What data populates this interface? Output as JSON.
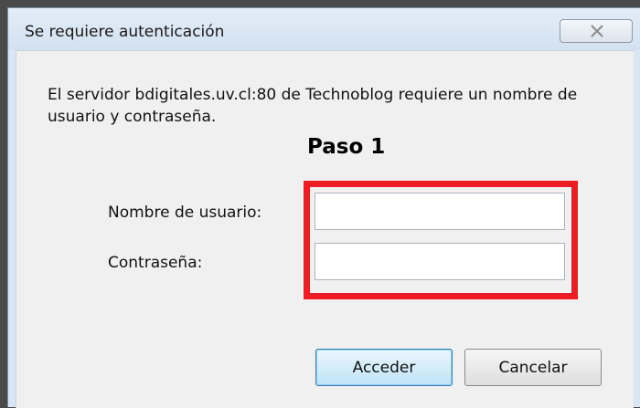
{
  "window": {
    "title": "Se requiere autenticación",
    "close_icon": "close-icon"
  },
  "dialog": {
    "message": "El servidor bdigitales.uv.cl:80 de Technoblog requiere un nombre de usuario y contraseña.",
    "step_label": "Paso 1",
    "username_label": "Nombre de usuario:",
    "username_value": "",
    "password_label": "Contraseña:",
    "password_value": "",
    "highlight_color": "#ee1c25"
  },
  "buttons": {
    "accept_label": "Acceder",
    "cancel_label": "Cancelar"
  }
}
